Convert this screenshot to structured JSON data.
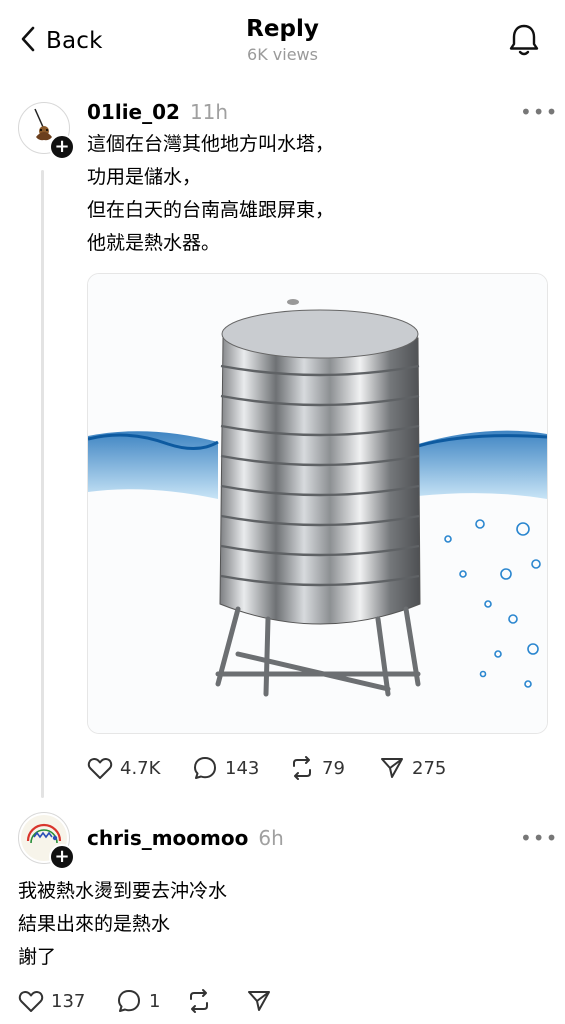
{
  "header": {
    "back_label": "Back",
    "title": "Reply",
    "subtitle": "6K views"
  },
  "post": {
    "username": "01lie_02",
    "time": "11h",
    "more": "•••",
    "text": "這個在台灣其他地方叫水塔，\n功用是儲水，\n但在白天的台南高雄跟屏東，\n他就是熱水器。",
    "stats": {
      "likes": "4.7K",
      "replies": "143",
      "reposts": "79",
      "shares": "275"
    }
  },
  "reply": {
    "username": "chris_moomoo",
    "time": "6h",
    "more": "•••",
    "text": "我被熱水燙到要去沖冷水\n結果出來的是熱水\n謝了",
    "stats": {
      "likes": "137",
      "replies": "1"
    }
  }
}
